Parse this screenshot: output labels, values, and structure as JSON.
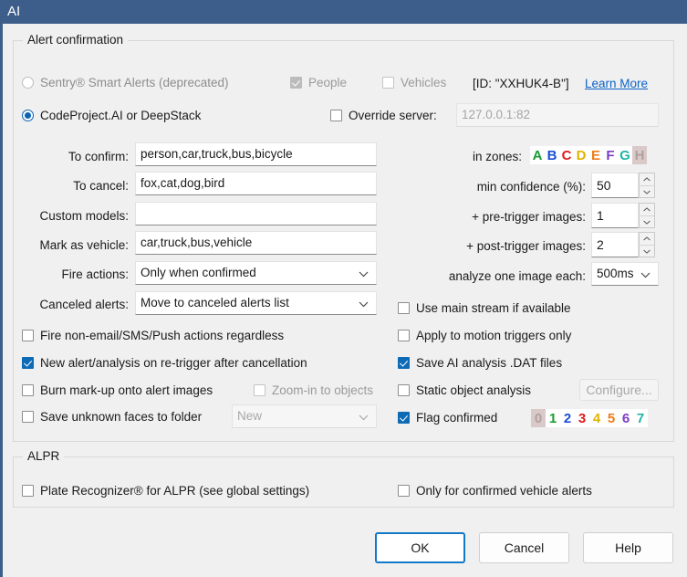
{
  "window": {
    "title": "AI",
    "titlebar_color": "#3d5d8a"
  },
  "groups": {
    "alert": {
      "title": "Alert confirmation"
    },
    "alpr": {
      "title": "ALPR"
    }
  },
  "engine": {
    "sentry": {
      "label": "Sentry® Smart Alerts (deprecated)",
      "selected": false,
      "enabled": false
    },
    "codeproject": {
      "label": "CodeProject.AI or DeepStack",
      "selected": true,
      "enabled": true
    },
    "people": {
      "label": "People",
      "checked": true,
      "enabled": false
    },
    "vehicles": {
      "label": "Vehicles",
      "checked": false,
      "enabled": false
    },
    "id_text": "[ID: \"XXHUK4-B\"]",
    "learn_more": "Learn More",
    "override_server": {
      "label": "Override server:",
      "checked": false,
      "value": "127.0.0.1:82",
      "enabled": false
    }
  },
  "fields": {
    "to_confirm": {
      "label": "To confirm:",
      "value": "person,car,truck,bus,bicycle"
    },
    "to_cancel": {
      "label": "To cancel:",
      "value": "fox,cat,dog,bird"
    },
    "custom_models": {
      "label": "Custom models:",
      "value": ""
    },
    "mark_as_vehicle": {
      "label": "Mark as vehicle:",
      "value": "car,truck,bus,vehicle"
    },
    "fire_actions": {
      "label": "Fire actions:",
      "value": "Only when confirmed"
    },
    "canceled_alerts": {
      "label": "Canceled alerts:",
      "value": "Move to canceled alerts list"
    }
  },
  "right_fields": {
    "in_zones": {
      "label": "in zones:"
    },
    "min_confidence": {
      "label": "min confidence (%):",
      "value": "50"
    },
    "pre_trigger": {
      "label": "+ pre-trigger images:",
      "value": "1"
    },
    "post_trigger": {
      "label": "+ post-trigger images:",
      "value": "2"
    },
    "analyze_each": {
      "label": "analyze one image each:",
      "value": "500ms"
    }
  },
  "zones": [
    {
      "letter": "A",
      "color": "#1a9c34",
      "on": true
    },
    {
      "letter": "B",
      "color": "#1b4fd6",
      "on": true
    },
    {
      "letter": "C",
      "color": "#e01b1b",
      "on": true
    },
    {
      "letter": "D",
      "color": "#e0b400",
      "on": true
    },
    {
      "letter": "E",
      "color": "#ef7d16",
      "on": true
    },
    {
      "letter": "F",
      "color": "#7b3fc4",
      "on": true
    },
    {
      "letter": "G",
      "color": "#1fb5a4",
      "on": true
    },
    {
      "letter": "H",
      "color": "#b0a0a0",
      "on": false
    }
  ],
  "flags": [
    {
      "digit": "0",
      "color": "#b0a0a0",
      "on": false
    },
    {
      "digit": "1",
      "color": "#1a9c34",
      "on": true
    },
    {
      "digit": "2",
      "color": "#1b4fd6",
      "on": true
    },
    {
      "digit": "3",
      "color": "#e01b1b",
      "on": true
    },
    {
      "digit": "4",
      "color": "#e0b400",
      "on": true
    },
    {
      "digit": "5",
      "color": "#ef7d16",
      "on": true
    },
    {
      "digit": "6",
      "color": "#7b3fc4",
      "on": true
    },
    {
      "digit": "7",
      "color": "#1fb5a4",
      "on": true
    }
  ],
  "left_checks": {
    "fire_non_email": {
      "label": "Fire non-email/SMS/Push actions regardless",
      "checked": false,
      "enabled": true
    },
    "new_alert": {
      "label": "New alert/analysis on re-trigger after cancellation",
      "checked": true,
      "enabled": true
    },
    "burn_markup": {
      "label": "Burn mark-up onto alert images",
      "checked": false,
      "enabled": true
    },
    "zoom_in": {
      "label": "Zoom-in to objects",
      "checked": false,
      "enabled": false
    },
    "save_faces": {
      "label": "Save unknown faces to folder",
      "checked": false,
      "enabled": true
    },
    "faces_folder": {
      "value": "New",
      "enabled": false
    }
  },
  "right_checks": {
    "use_main_stream": {
      "label": "Use main stream if available",
      "checked": false,
      "enabled": true
    },
    "apply_motion": {
      "label": "Apply to motion triggers only",
      "checked": false,
      "enabled": true
    },
    "save_dat": {
      "label": "Save AI analysis .DAT files",
      "checked": true,
      "enabled": true
    },
    "static_object": {
      "label": "Static object analysis",
      "checked": false,
      "enabled": true
    },
    "configure": {
      "label": "Configure...",
      "enabled": false
    },
    "flag_confirmed": {
      "label": "Flag confirmed",
      "checked": true,
      "enabled": true
    }
  },
  "alpr": {
    "plate_recognizer": {
      "label": "Plate Recognizer® for ALPR (see global settings)",
      "checked": false
    },
    "only_confirmed": {
      "label": "Only for confirmed vehicle alerts",
      "checked": false
    }
  },
  "buttons": {
    "ok": "OK",
    "cancel": "Cancel",
    "help": "Help"
  },
  "colors": {
    "accent": "#0d6ab4",
    "link": "#0b63c7",
    "titlebar": "#3d5d8a"
  }
}
